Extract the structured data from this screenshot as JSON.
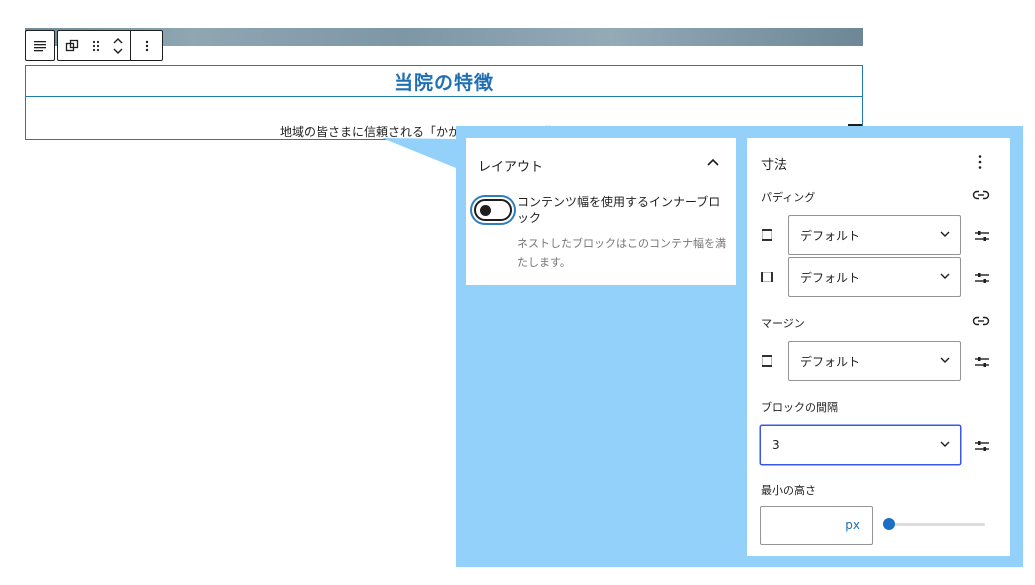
{
  "editor": {
    "heading_text": "当院の特徴",
    "paragraph_text": "地域の皆さまに信頼される「かかりつけ医」を目指して"
  },
  "toolbar": {
    "buttons": [
      "list-view",
      "group-transform",
      "drag-handle",
      "move-up-down",
      "options"
    ]
  },
  "layout_panel": {
    "title": "レイアウト",
    "toggle_label": "コンテンツ幅を使用するインナーブロック",
    "toggle_help": "ネストしたブロックはこのコンテナ幅を満たします。",
    "toggle_on": false
  },
  "dimensions_panel": {
    "title": "寸法",
    "padding": {
      "label": "パディング",
      "vertical_value": "デフォルト",
      "horizontal_value": "デフォルト"
    },
    "margin": {
      "label": "マージン",
      "value": "デフォルト"
    },
    "block_spacing": {
      "label": "ブロックの間隔",
      "value": "3"
    },
    "min_height": {
      "label": "最小の高さ",
      "value": "",
      "unit": "px",
      "slider_value": 0
    }
  },
  "colors": {
    "callout_bg": "#93d1fb",
    "heading_blue": "#1f6fb5",
    "block_outline": "#1f7bb0",
    "focus_blue": "#3858e9",
    "slider_blue": "#1d6fc6"
  }
}
